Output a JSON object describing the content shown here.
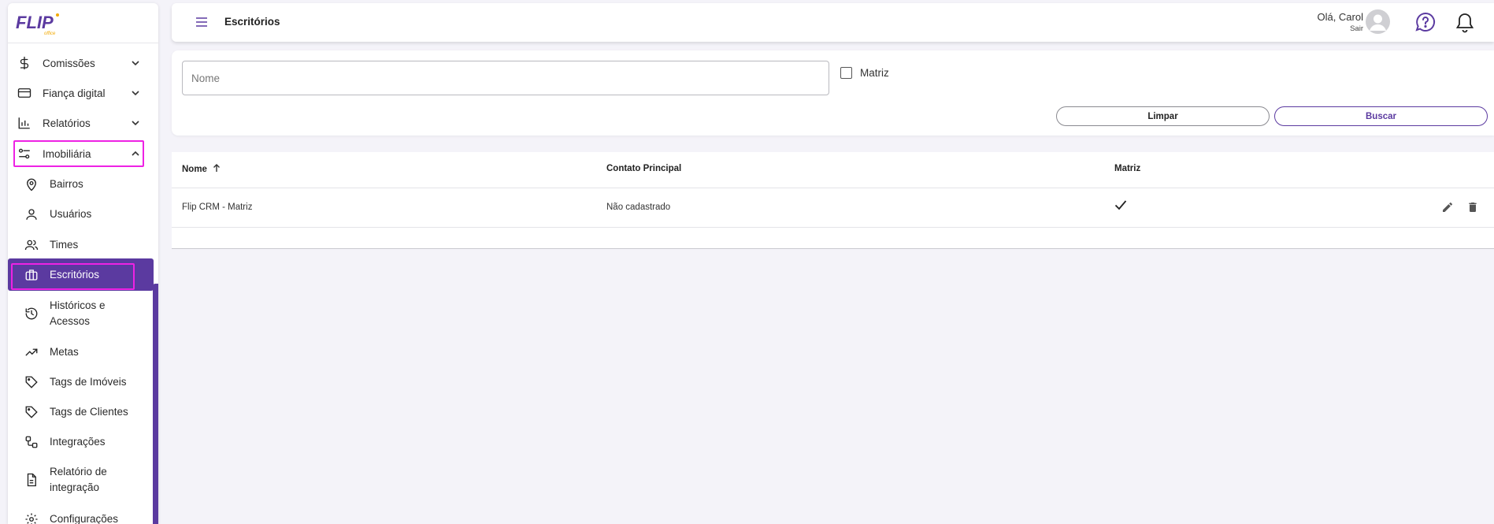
{
  "brand": {
    "logo_text": "FLIP",
    "logo_sub": "office"
  },
  "colors": {
    "accent": "#5b3aa0",
    "highlight": "#ee22e4",
    "background": "#f4f3f9"
  },
  "sidebar": {
    "items": [
      {
        "label": "Comissões",
        "icon": "dollar-icon",
        "expanded": false
      },
      {
        "label": "Fiança digital",
        "icon": "credit-card-icon",
        "expanded": false
      },
      {
        "label": "Relatórios",
        "icon": "bar-chart-icon",
        "expanded": false
      },
      {
        "label": "Imobiliária",
        "icon": "sliders-icon",
        "expanded": true
      }
    ],
    "subitems": [
      {
        "label": "Bairros",
        "icon": "map-pin-icon"
      },
      {
        "label": "Usuários",
        "icon": "user-icon"
      },
      {
        "label": "Times",
        "icon": "users-icon"
      },
      {
        "label": "Escritórios",
        "icon": "briefcase-icon",
        "active": true
      },
      {
        "label": "Históricos e Acessos",
        "icon": "history-icon"
      },
      {
        "label": "Metas",
        "icon": "trending-up-icon"
      },
      {
        "label": "Tags de Imóveis",
        "icon": "tag-icon"
      },
      {
        "label": "Tags de Clientes",
        "icon": "tag-icon"
      },
      {
        "label": "Integrações",
        "icon": "integration-icon"
      },
      {
        "label": "Relatório de integração",
        "icon": "document-icon"
      },
      {
        "label": "Configurações",
        "icon": "gear-icon"
      }
    ]
  },
  "header": {
    "title": "Escritórios",
    "greeting": "Olá, Carol",
    "logout": "Sair"
  },
  "filters": {
    "name_placeholder": "Nome",
    "name_value": "",
    "matriz_label": "Matriz",
    "matriz_checked": false,
    "clear_label": "Limpar",
    "search_label": "Buscar"
  },
  "table": {
    "columns": [
      "Nome",
      "Contato Principal",
      "Matriz"
    ],
    "sort_column": "Nome",
    "sort_direction": "asc",
    "rows": [
      {
        "nome": "Flip CRM - Matriz",
        "contato": "Não cadastrado",
        "matriz": true
      }
    ]
  }
}
